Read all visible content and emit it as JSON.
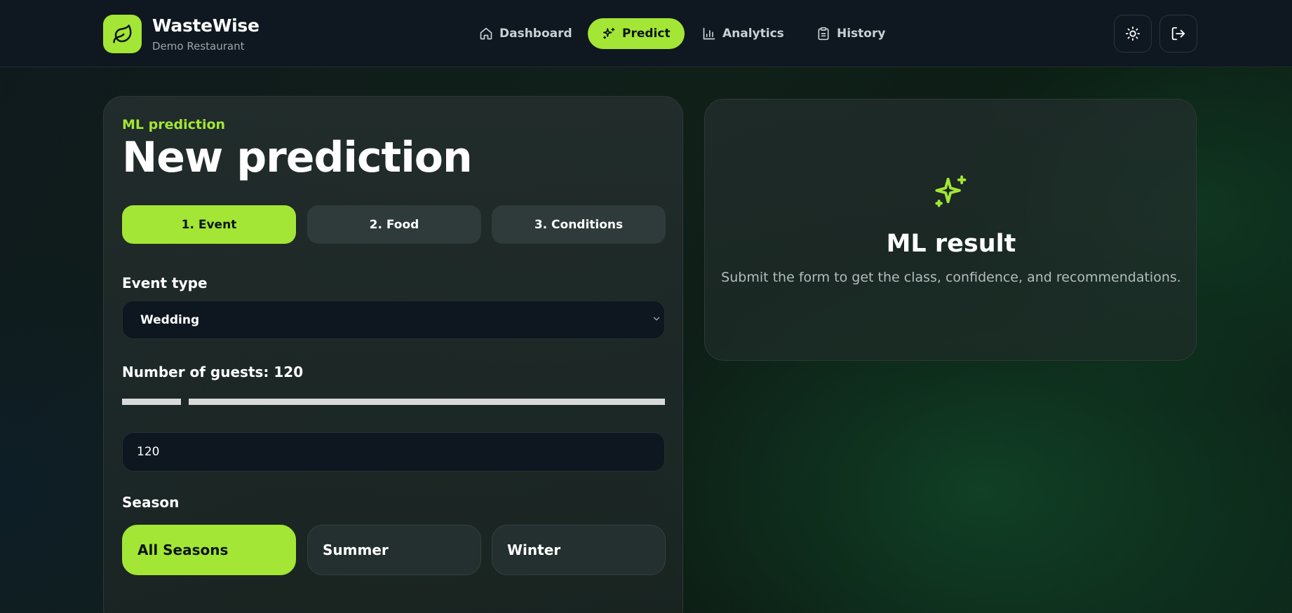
{
  "brand": {
    "name": "WasteWise",
    "subtitle": "Demo Restaurant",
    "logo_icon": "leaf-icon"
  },
  "nav": {
    "items": [
      {
        "label": "Dashboard",
        "icon": "home-icon",
        "active": false
      },
      {
        "label": "Predict",
        "icon": "sparkles-icon",
        "active": true
      },
      {
        "label": "Analytics",
        "icon": "bar-chart-icon",
        "active": false
      },
      {
        "label": "History",
        "icon": "clipboard-icon",
        "active": false
      }
    ]
  },
  "actions": {
    "theme_icon": "sun-icon",
    "logout_icon": "logout-icon"
  },
  "form": {
    "eyebrow": "ML prediction",
    "title": "New prediction",
    "steps": [
      {
        "label": "1. Event",
        "active": true
      },
      {
        "label": "2. Food",
        "active": false
      },
      {
        "label": "3. Conditions",
        "active": false
      }
    ],
    "event_type_label": "Event type",
    "event_type_value": "Wedding",
    "guests_label": "Number of guests: 120",
    "guests_value": "120",
    "guests_slider_fraction": 0.11,
    "season_label": "Season",
    "seasons": [
      {
        "label": "All Seasons",
        "active": true
      },
      {
        "label": "Summer",
        "active": false
      },
      {
        "label": "Winter",
        "active": false
      }
    ]
  },
  "result": {
    "icon": "sparkles-icon",
    "title": "ML result",
    "description": "Submit the form to get the class, confidence, and recommendations."
  },
  "colors": {
    "accent": "#a3e635",
    "header_bg": "#0f1820",
    "input_bg": "#0e1620"
  }
}
